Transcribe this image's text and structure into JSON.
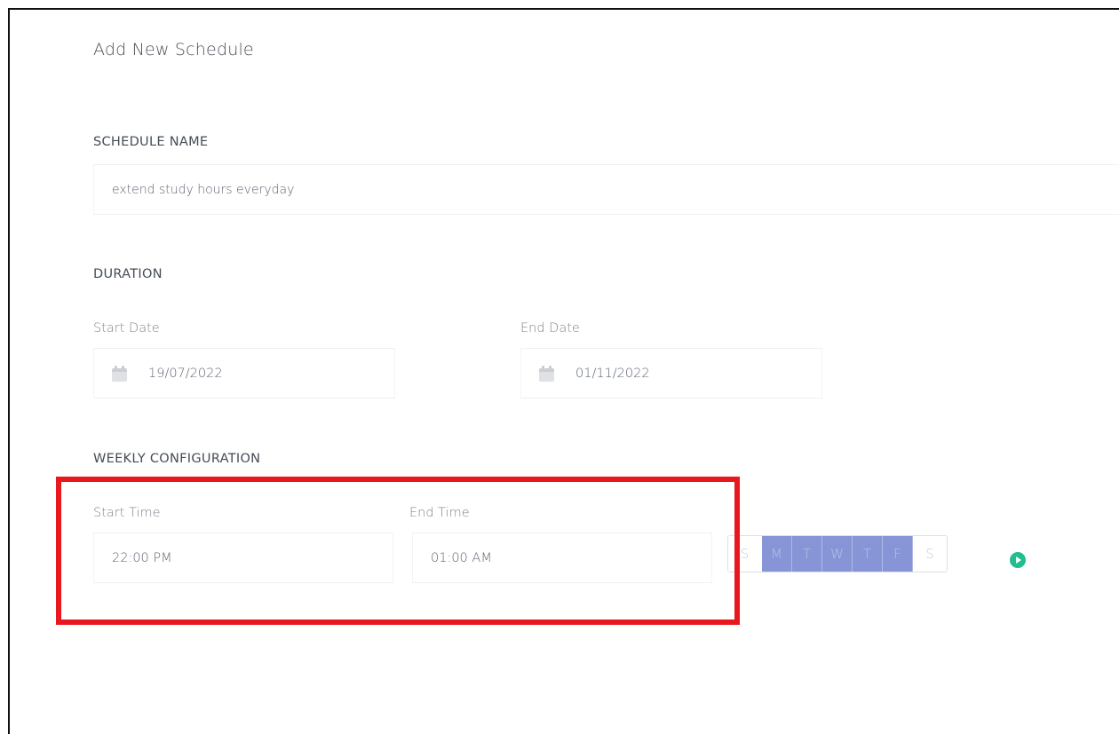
{
  "page": {
    "title": "Add New Schedule"
  },
  "schedule_name": {
    "section_label": "SCHEDULE NAME",
    "value": "extend study hours everyday"
  },
  "duration": {
    "section_label": "DURATION",
    "start_date_label": "Start Date",
    "start_date_value": "19/07/2022",
    "end_date_label": "End Date",
    "end_date_value": "01/11/2022",
    "icon": "calendar-icon"
  },
  "weekly": {
    "section_label": "WEEKLY CONFIGURATION",
    "start_time_label": "Start Time",
    "start_time_value": "22:00 PM",
    "end_time_label": "End Time",
    "end_time_value": "01:00 AM",
    "days": [
      {
        "label": "S",
        "selected": false
      },
      {
        "label": "M",
        "selected": true
      },
      {
        "label": "T",
        "selected": true
      },
      {
        "label": "W",
        "selected": true
      },
      {
        "label": "T",
        "selected": true
      },
      {
        "label": "F",
        "selected": true
      },
      {
        "label": "S",
        "selected": false
      }
    ],
    "add_icon": "add-circle-icon"
  },
  "colors": {
    "highlight_box": "#e8181e",
    "day_selected": "#8795d6",
    "add_button": "#1fbf8f"
  }
}
